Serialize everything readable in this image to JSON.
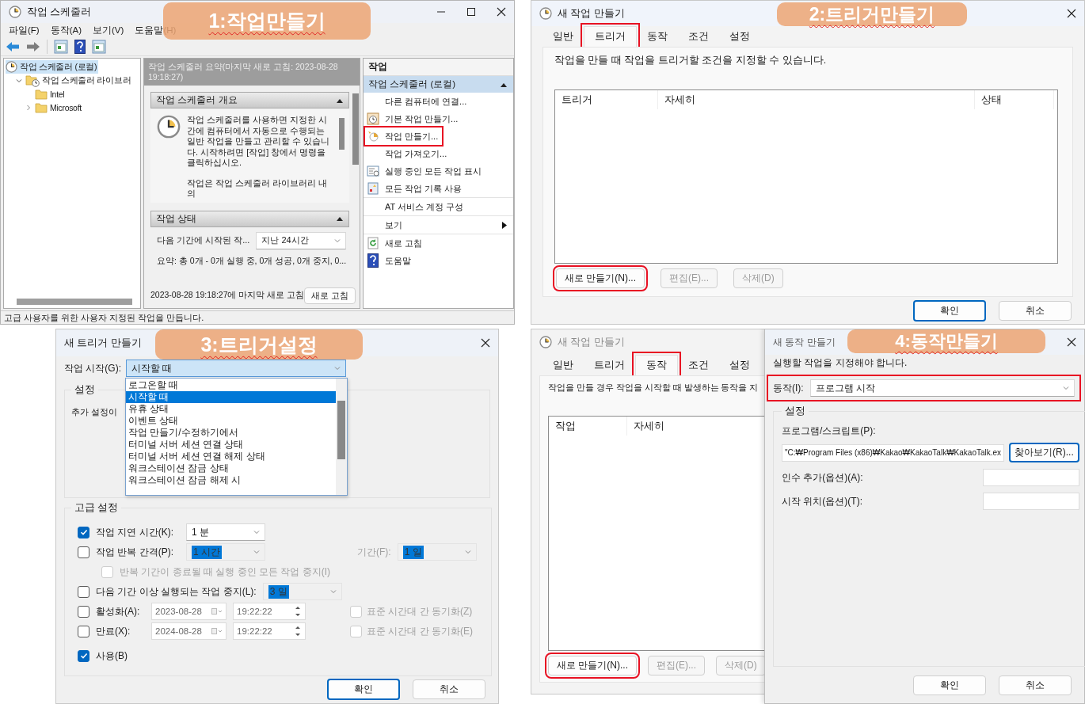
{
  "step1": {
    "callout": "1:작업만들기",
    "window": {
      "title": "작업 스케줄러"
    },
    "menu": [
      "파일(F)",
      "동작(A)",
      "보기(V)",
      "도움말(H)"
    ],
    "tree": [
      {
        "label": "작업 스케줄러 (로컬)",
        "selected": true,
        "children": [
          {
            "label": "작업 스케줄러 라이브러",
            "selected": false,
            "expanded": true,
            "children": [
              {
                "label": "Intel",
                "selected": false
              },
              {
                "label": "Microsoft",
                "selected": false,
                "expanded": false
              }
            ]
          }
        ]
      }
    ],
    "summary_header": "작업 스케줄러 요약(마지막 새로 고침: 2023-08-28 19:18:27)",
    "sections": [
      {
        "kind": "overview",
        "title": "작업 스케줄러 개요",
        "expanded": true,
        "paragraphs": [
          "작업 스케줄러를 사용하면 지정한 시간에 컴퓨터에서 자동으로 수행되는 일반 작업을 만들고 관리할 수 있습니다. 시작하려면 [작업] 창에서 명령을 클릭하십시오.",
          "작업은 작업 스케줄러 라이브러리 내의"
        ]
      },
      {
        "kind": "status",
        "title": "작업 상태",
        "expanded": true,
        "period_label": "다음 기간에 시작된 작...",
        "period_value": "지난 24시간",
        "summary": "요약: 총 0개 - 0개 실행 중, 0개 성공, 0개 중지, 0..."
      }
    ],
    "refresh_note": "2023-08-28 19:18:27에 마지막 새로 고침",
    "refresh_button": "새로 고침",
    "actions": {
      "title": "작업",
      "group": "작업 스케줄러 (로컬)",
      "group_expanded": true,
      "items": [
        {
          "label": "다른 컴퓨터에 연결...",
          "marked": false,
          "group_start": false,
          "submenu": false
        },
        {
          "label": "기본 작업 만들기...",
          "marked": false,
          "group_start": false,
          "submenu": false
        },
        {
          "label": "작업 만들기...",
          "marked": true,
          "group_start": false,
          "submenu": false
        },
        {
          "label": "작업 가져오기...",
          "marked": false,
          "group_start": false,
          "submenu": false
        },
        {
          "label": "실행 중인 모든 작업 표시",
          "marked": false,
          "group_start": false,
          "submenu": false
        },
        {
          "label": "모든 작업 기록 사용",
          "marked": false,
          "group_start": false,
          "submenu": false
        },
        {
          "label": "AT 서비스 계정 구성",
          "marked": false,
          "group_start": true,
          "submenu": false
        },
        {
          "label": "보기",
          "marked": false,
          "group_start": true,
          "submenu": true
        },
        {
          "label": "새로 고침",
          "marked": false,
          "group_start": true,
          "submenu": false
        },
        {
          "label": "도움말",
          "marked": false,
          "group_start": false,
          "submenu": false
        }
      ]
    },
    "status_bar": "고급 사용자를 위한 사용자 지정된 작업을 만듭니다."
  },
  "step2": {
    "callout": "2:트리거만들기",
    "window": {
      "title": "새 작업 만들기"
    },
    "tabs": [
      {
        "label": "일반",
        "selected": false,
        "marked": false
      },
      {
        "label": "트리거",
        "selected": true,
        "marked": true
      },
      {
        "label": "동작",
        "selected": false,
        "marked": false
      },
      {
        "label": "조건",
        "selected": false,
        "marked": false
      },
      {
        "label": "설정",
        "selected": false,
        "marked": false
      }
    ],
    "description": "작업을 만들 때 작업을 트리거할 조건을 지정할 수 있습니다.",
    "columns": [
      "트리거",
      "자세히",
      "상태"
    ],
    "buttons": [
      {
        "label": "새로 만들기(N)...",
        "disabled": false,
        "marked": true
      },
      {
        "label": "편집(E)...",
        "disabled": true,
        "marked": false
      },
      {
        "label": "삭제(D)",
        "disabled": true,
        "marked": false
      }
    ],
    "dialog_buttons": [
      {
        "label": "확인",
        "default": true
      },
      {
        "label": "취소",
        "default": false
      }
    ]
  },
  "step3": {
    "callout": "3:트리거설정",
    "window": {
      "title": "새 트리거 만들기"
    },
    "start_label": "작업 시작(G):",
    "start_value": "시작할 때",
    "start_options": [
      {
        "label": "로그온할 때",
        "selected": false
      },
      {
        "label": "시작할 때",
        "selected": true
      },
      {
        "label": "유휴 상태",
        "selected": false
      },
      {
        "label": "이벤트 상태",
        "selected": false
      },
      {
        "label": "작업 만들기/수정하기에서",
        "selected": false
      },
      {
        "label": "터미널 서버 세션 연결 상태",
        "selected": false
      },
      {
        "label": "터미널 서버 세션 연결 해제 상태",
        "selected": false
      },
      {
        "label": "워크스테이션 잠금 상태",
        "selected": false
      },
      {
        "label": "워크스테이션 잠금 해제 시",
        "selected": false
      }
    ],
    "settings_group": "설정",
    "settings_note": "추가 설정이",
    "advanced_group": "고급 설정",
    "advanced_rows": [
      {
        "kind": "combo",
        "label": "작업 지연 시간(K):",
        "checked": true,
        "value": "1 분",
        "value_disabled": false
      },
      {
        "kind": "combo2",
        "label": "작업 반복 간격(P):",
        "checked": false,
        "value": "1 시간",
        "value_disabled": true,
        "label2": "기간(F):",
        "value2": "1 일"
      },
      {
        "kind": "sub",
        "label": "반복 기간이 종료될 때 실행 중인 모든 작업 중지(I)",
        "checked": false,
        "disabled": true
      },
      {
        "kind": "combo",
        "label": "다음 기간 이상 실행되는 작업 중지(L):",
        "checked": false,
        "value": "3 일",
        "value_disabled": true
      },
      {
        "kind": "datetime",
        "label": "활성화(A):",
        "checked": false,
        "date": "2023-08-28",
        "time": "19:22:22",
        "sync_label": "표준 시간대 간 동기화(Z)",
        "sync_checked": false
      },
      {
        "kind": "datetime",
        "label": "만료(X):",
        "checked": false,
        "date": "2024-08-28",
        "time": "19:22:22",
        "sync_label": "표준 시간대 간 동기화(E)",
        "sync_checked": false
      },
      {
        "kind": "check",
        "label": "사용(B)",
        "checked": true
      }
    ],
    "dialog_buttons": [
      {
        "label": "확인",
        "default": true
      },
      {
        "label": "취소",
        "default": false
      }
    ]
  },
  "step4": {
    "callout": "4:동작만들기",
    "task_window": {
      "title": "새 작업 만들기",
      "tabs": [
        {
          "label": "일반",
          "selected": false,
          "marked": false
        },
        {
          "label": "트리거",
          "selected": false,
          "marked": false
        },
        {
          "label": "동작",
          "selected": true,
          "marked": true
        },
        {
          "label": "조건",
          "selected": false,
          "marked": false
        },
        {
          "label": "설정",
          "selected": false,
          "marked": false
        }
      ],
      "description": "작업을 만들 경우 작업을 시작할 때 발생하는 동작을 지",
      "columns": [
        "작업",
        "자세히"
      ],
      "buttons": [
        {
          "label": "새로 만들기(N)...",
          "disabled": false,
          "marked": true
        },
        {
          "label": "편집(E)...",
          "disabled": true,
          "marked": false
        },
        {
          "label": "삭제(D)",
          "disabled": true,
          "marked": false
        }
      ]
    },
    "action_dialog": {
      "title": "새 동작 만들기",
      "description": "실행할 작업을 지정해야 합니다.",
      "action_label": "동작(I):",
      "action_value": "프로그램 시작",
      "action_marked": true,
      "settings_group": "설정",
      "program_label": "프로그램/스크립트(P):",
      "program_value": "\"C:₩Program Files (x86)₩Kakao₩KakaoTalk₩KakaoTalk.ex",
      "browse_button": "찾아보기(R)...",
      "fields": [
        {
          "label": "인수 추가(옵션)(A):"
        },
        {
          "label": "시작 위치(옵션)(T):"
        }
      ],
      "dialog_buttons": [
        {
          "label": "확인",
          "default": false
        },
        {
          "label": "취소",
          "default": false
        }
      ]
    }
  }
}
